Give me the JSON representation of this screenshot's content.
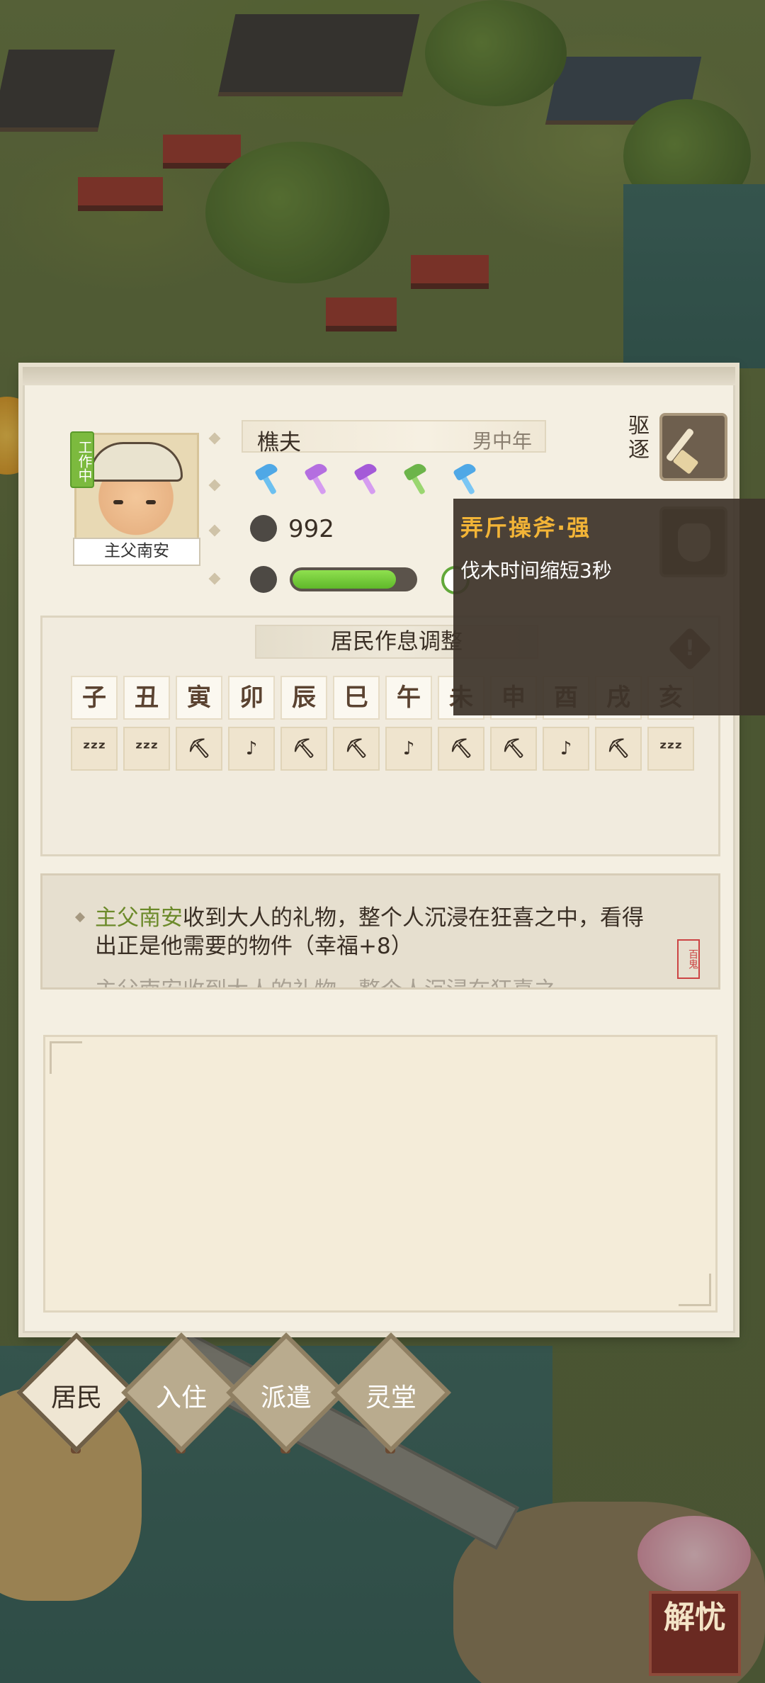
{
  "character": {
    "status": "工作中",
    "name": "主父南安",
    "job": "樵夫",
    "gender_age": "男中年",
    "wealth": "992",
    "happiness": 0.85
  },
  "actions": {
    "expel_label": "驱逐",
    "expel_icon": "broom-icon",
    "gift_icon": "gift-bag-icon"
  },
  "tools": [
    "blue-axe-icon",
    "purple-axe-icon",
    "purple-axe-icon",
    "green-axe-icon",
    "blue-axe-icon"
  ],
  "tooltip": {
    "title": "弄斤操斧·强",
    "description": "伐木时间缩短3秒"
  },
  "schedule": {
    "title": "居民作息调整",
    "hours": [
      "子",
      "丑",
      "寅",
      "卯",
      "辰",
      "巳",
      "午",
      "未",
      "申",
      "酉",
      "戌",
      "亥"
    ],
    "activities": [
      "sleep",
      "sleep",
      "work",
      "leisure",
      "work",
      "work",
      "leisure",
      "work",
      "work",
      "leisure",
      "work",
      "sleep"
    ],
    "symbols": {
      "sleep": "ᶻᶻᶻ",
      "work": "⛏",
      "leisure": "♪"
    }
  },
  "log": {
    "entry_name": "主父南安",
    "entry_text": "收到大人的礼物，整个人沉浸在狂喜之中，看得出正是他需要的物件（幸福+8）",
    "faded_text": "主父南安收到大人的礼物，整个人沉浸在狂喜之",
    "seal": "百鬼"
  },
  "nav": {
    "items": [
      "居民",
      "入住",
      "派遣",
      "灵堂"
    ],
    "active": 0
  },
  "jieyou_button": "解忧"
}
